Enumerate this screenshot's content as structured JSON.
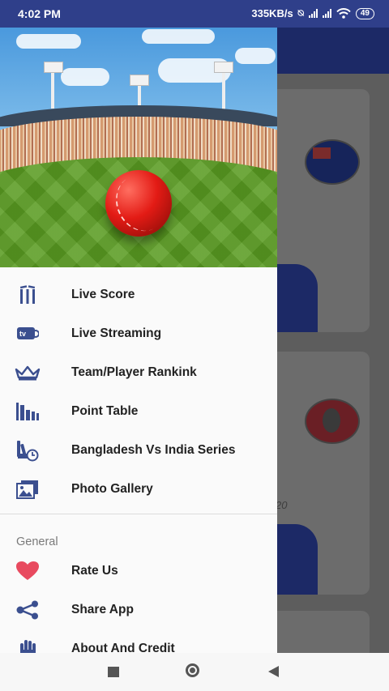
{
  "status_bar": {
    "time": "4:02 PM",
    "network_speed": "335KB/s",
    "battery": "49"
  },
  "background": {
    "year_fragment": "20"
  },
  "drawer": {
    "items": [
      {
        "label": "Live Score",
        "icon": "cricket-stumps-icon"
      },
      {
        "label": "Live Streaming",
        "icon": "tv-icon"
      },
      {
        "label": "Team/Player Rankink",
        "icon": "crown-icon"
      },
      {
        "label": "Point Table",
        "icon": "bar-chart-icon"
      },
      {
        "label": "Bangladesh Vs India Series",
        "icon": "bat-clock-icon"
      },
      {
        "label": "Photo Gallery",
        "icon": "photo-gallery-icon"
      }
    ],
    "section_title": "General",
    "general_items": [
      {
        "label": "Rate Us",
        "icon": "heart-icon"
      },
      {
        "label": "Share App",
        "icon": "share-icon"
      },
      {
        "label": "About And Credit",
        "icon": "hand-icon"
      }
    ]
  },
  "colors": {
    "primary": "#2f3f8a",
    "icon": "#3b4f8f",
    "heart": "#e84a5f"
  }
}
